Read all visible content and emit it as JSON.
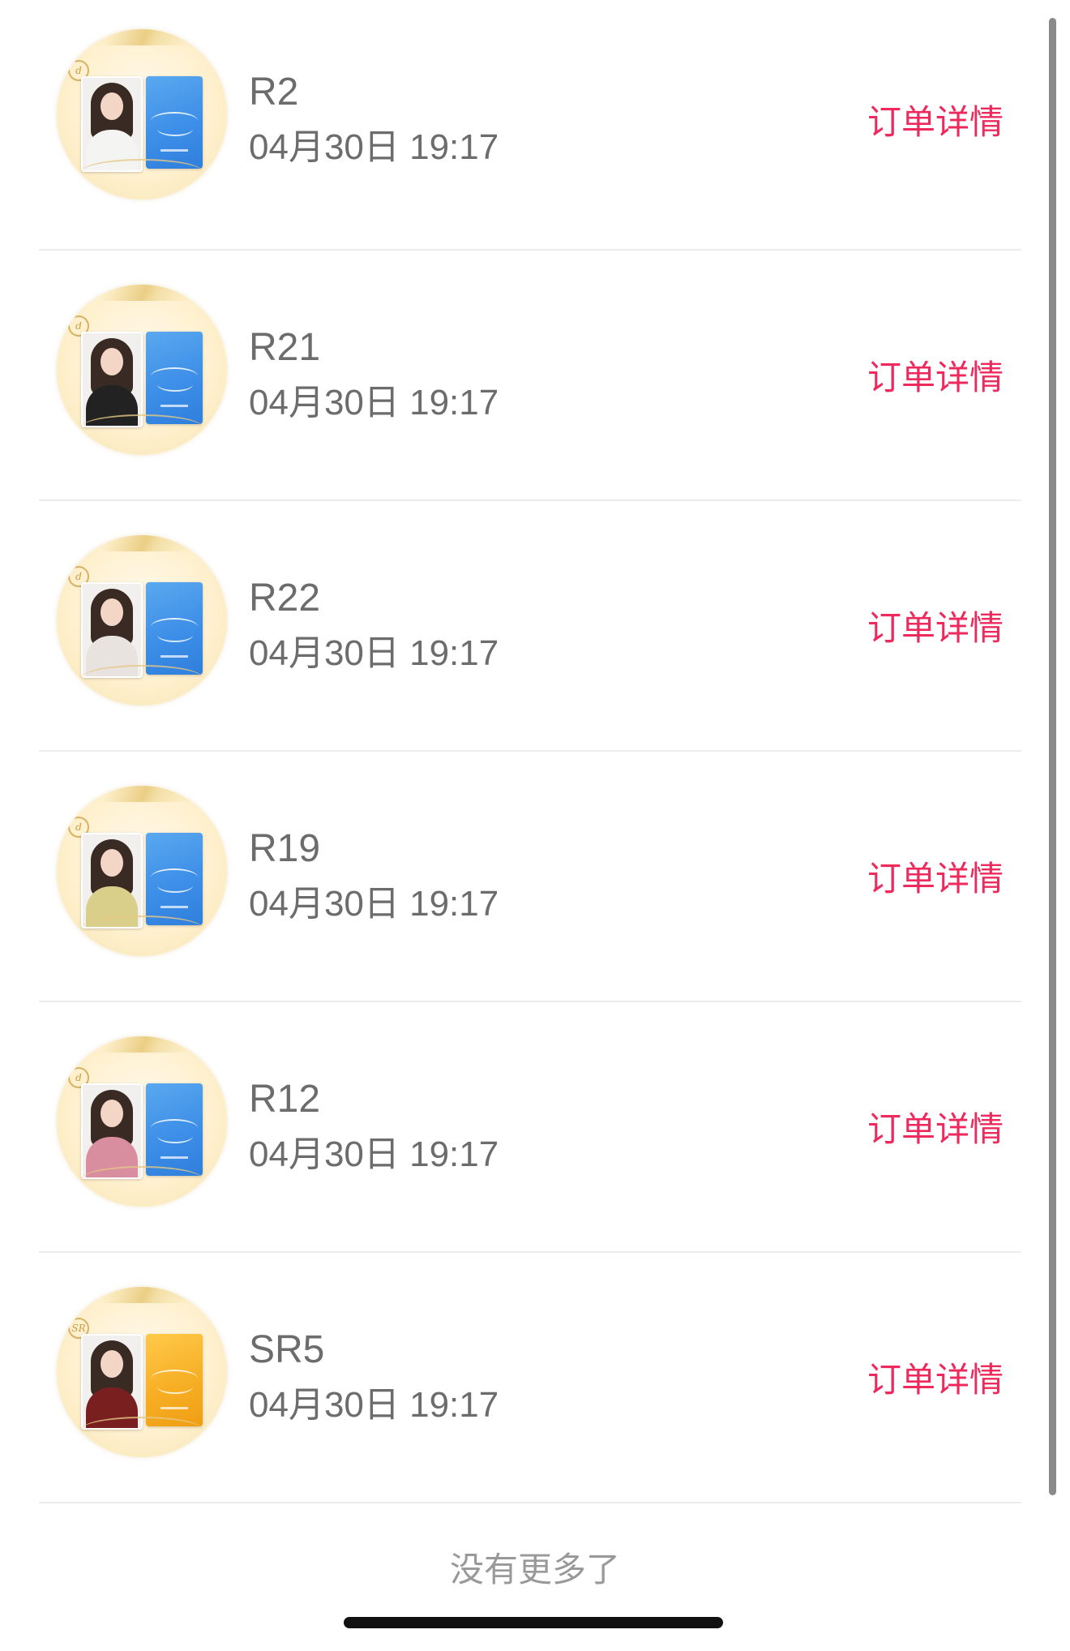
{
  "orders": [
    {
      "name": "R2",
      "time": "04月30日 19:17",
      "detail_label": "订单详情",
      "thumb": {
        "card_color": "blue",
        "outfit_color": "#f4f4f2",
        "card_icon": "blue-script-card-icon"
      }
    },
    {
      "name": "R21",
      "time": "04月30日 19:17",
      "detail_label": "订单详情",
      "thumb": {
        "card_color": "blue",
        "outfit_color": "#222222",
        "card_icon": "blue-script-card-icon"
      }
    },
    {
      "name": "R22",
      "time": "04月30日 19:17",
      "detail_label": "订单详情",
      "thumb": {
        "card_color": "blue",
        "outfit_color": "#e8e3df",
        "card_icon": "blue-script-card-icon"
      }
    },
    {
      "name": "R19",
      "time": "04月30日 19:17",
      "detail_label": "订单详情",
      "thumb": {
        "card_color": "blue",
        "outfit_color": "#d9cf8a",
        "card_icon": "blue-script-card-icon"
      }
    },
    {
      "name": "R12",
      "time": "04月30日 19:17",
      "detail_label": "订单详情",
      "thumb": {
        "card_color": "blue",
        "outfit_color": "#d98ea0",
        "card_icon": "blue-script-card-icon"
      }
    },
    {
      "name": "SR5",
      "time": "04月30日 19:17",
      "detail_label": "订单详情",
      "thumb": {
        "card_color": "gold",
        "outfit_color": "#7a1f1f",
        "card_icon": "gold-script-card-icon"
      }
    }
  ],
  "footer": {
    "no_more_text": "没有更多了"
  },
  "colors": {
    "detail_link": "#ee2a5d",
    "primary_text": "#6c6c6c",
    "muted_text": "#999999",
    "divider": "#ececec"
  }
}
